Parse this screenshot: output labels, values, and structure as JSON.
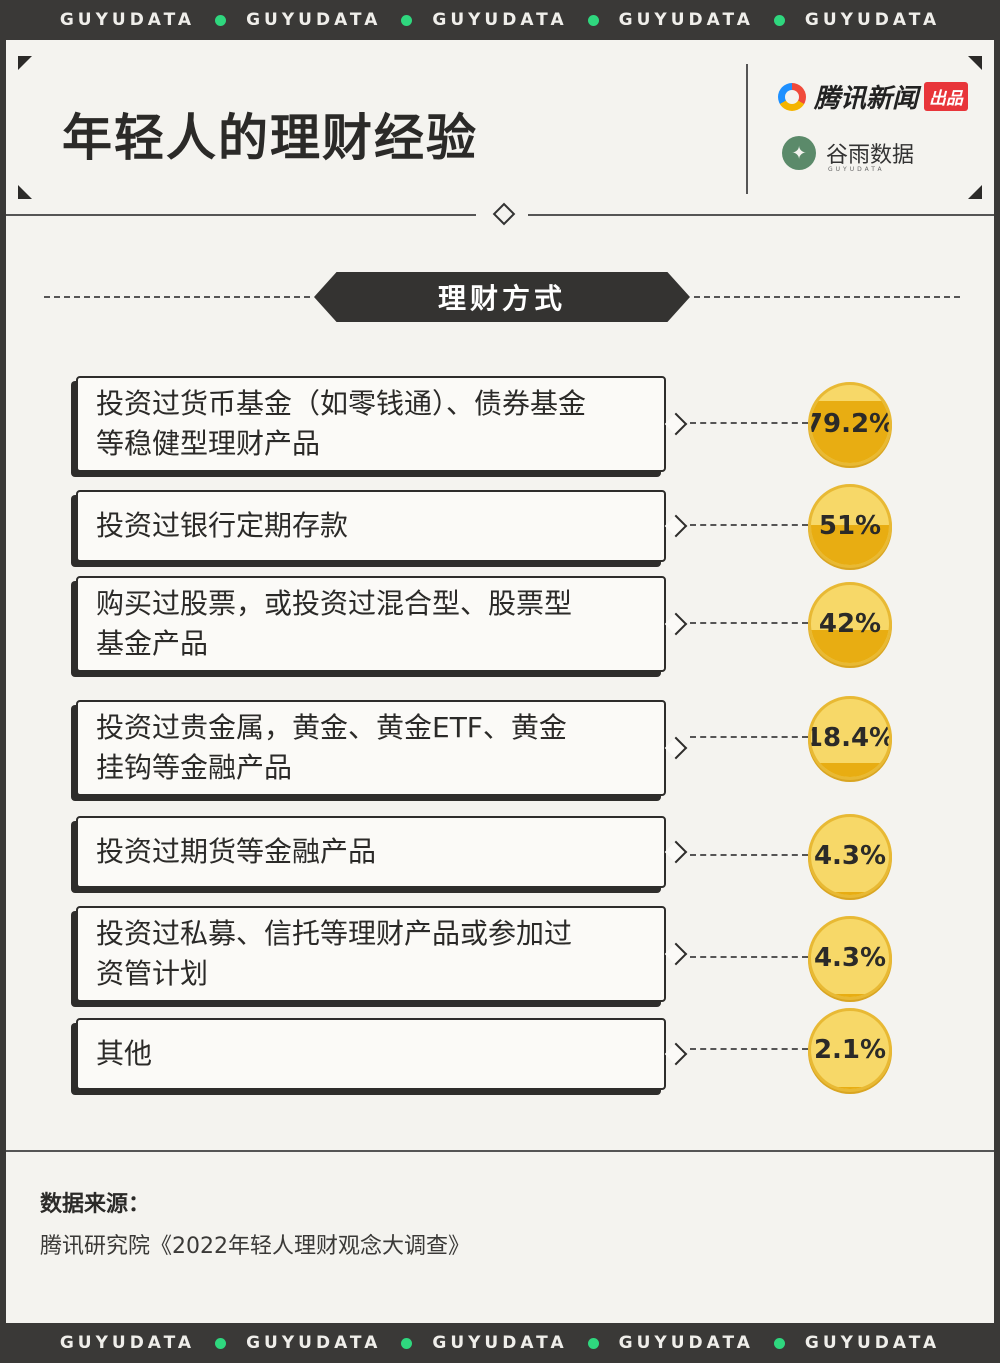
{
  "brand_band": {
    "items": [
      "GUYUDATA",
      "GUYUDATA",
      "GUYUDATA",
      "GUYUDATA",
      "GUYUDATA"
    ]
  },
  "header": {
    "title": "年轻人的理财经验",
    "tencent_logo_text": "腾讯新闻",
    "tencent_logo_tag": "出品",
    "guyu_logo_text": "谷雨数据",
    "guyu_logo_sub": "GUYUDATA"
  },
  "section": {
    "title": "理财方式"
  },
  "chart_data": {
    "type": "bar",
    "title": "理财方式",
    "categories": [
      "投资过货币基金（如零钱通）、债券基金等稳健型理财产品",
      "投资过银行定期存款",
      "购买过股票，或投资过混合型、股票型基金产品",
      "投资过贵金属，黄金、黄金ETF、黄金挂钩等金融产品",
      "投资过期货等金融产品",
      "投资过私募、信托等理财产品或参加过资管计划",
      "其他"
    ],
    "lines": [
      [
        "投资过货币基金（如零钱通）、债券基金",
        "等稳健型理财产品"
      ],
      [
        "投资过银行定期存款"
      ],
      [
        "购买过股票，或投资过混合型、股票型",
        "基金产品"
      ],
      [
        "投资过贵金属，黄金、黄金ETF、黄金",
        "挂钩等金融产品"
      ],
      [
        "投资过期货等金融产品"
      ],
      [
        "投资过私募、信托等理财产品或参加过",
        "资管计划"
      ],
      [
        "其他"
      ]
    ],
    "values": [
      79.2,
      51,
      42,
      18.4,
      4.3,
      4.3,
      2.1
    ],
    "labels": [
      "79.2%",
      "51%",
      "42%",
      "18.4%",
      "4.3%",
      "4.3%",
      "2.1%"
    ],
    "unit": "%",
    "ylim": [
      0,
      100
    ],
    "colors": {
      "coin_light": "#f7d868",
      "coin_fill": "#e8ad12",
      "coin_border": "#e8b934"
    }
  },
  "source": {
    "label": "数据来源：",
    "text": "腾讯研究院《2022年轻人理财观念大调查》"
  }
}
